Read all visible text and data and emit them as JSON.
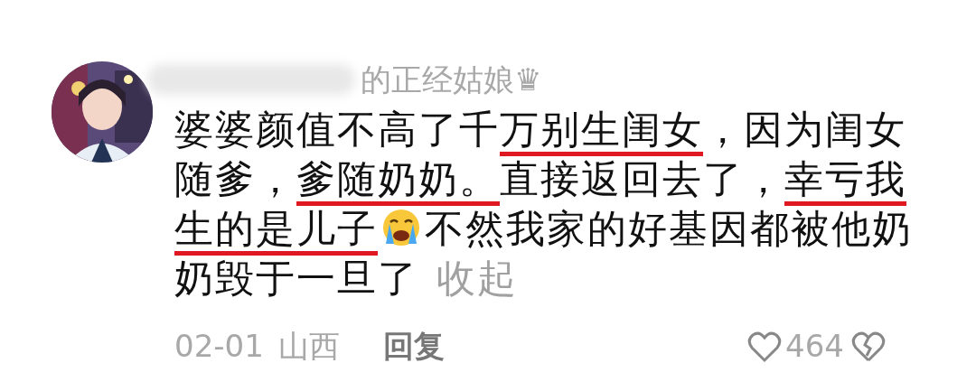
{
  "comment": {
    "author": {
      "name": "的正经姑娘",
      "badge": "♛",
      "redacted": true
    },
    "segments": [
      {
        "kind": "text",
        "text": "婆婆颜值不高了千",
        "underlined": false
      },
      {
        "kind": "text",
        "text": "万别生闺女",
        "underlined": true
      },
      {
        "kind": "text",
        "text": "，因为闺女随爹，",
        "underlined": false
      },
      {
        "kind": "text",
        "text": "爹随奶奶。",
        "underlined": true
      },
      {
        "kind": "text",
        "text": "直接返回去了，",
        "underlined": false
      },
      {
        "kind": "text",
        "text": "幸亏我生的是儿子",
        "underlined": true
      },
      {
        "kind": "emoji"
      },
      {
        "kind": "text",
        "text": "不然我家的好基因都被他奶奶毁于一旦了",
        "underlined": false
      }
    ],
    "collapse_link": "收起",
    "date": "02-01",
    "location": "山西",
    "reply": "回复",
    "likes": "464"
  }
}
